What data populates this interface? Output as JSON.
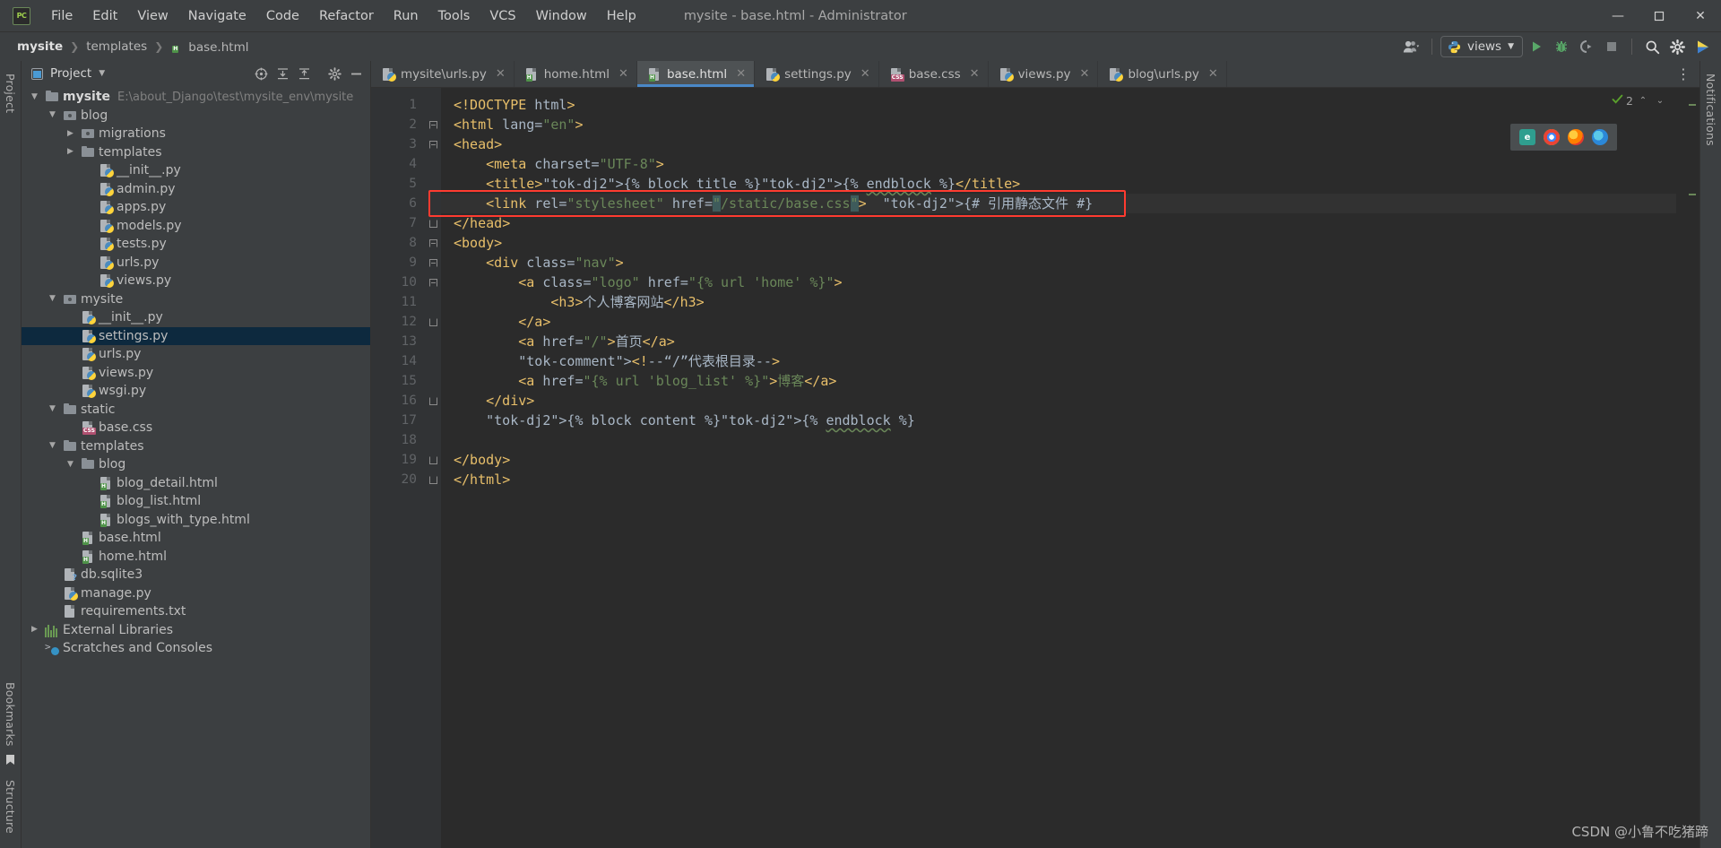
{
  "window": {
    "title": "mysite - base.html - Administrator",
    "logo_text": "PC",
    "minimize": "—",
    "maximize": "❐",
    "close": "✕"
  },
  "menubar": [
    {
      "label": "File"
    },
    {
      "label": "Edit"
    },
    {
      "label": "View"
    },
    {
      "label": "Navigate"
    },
    {
      "label": "Code"
    },
    {
      "label": "Refactor"
    },
    {
      "label": "Run"
    },
    {
      "label": "Tools"
    },
    {
      "label": "VCS"
    },
    {
      "label": "Window"
    },
    {
      "label": "Help"
    }
  ],
  "breadcrumb": {
    "items": [
      "mysite",
      "templates",
      "base.html"
    ],
    "separator": "❯"
  },
  "toolbar": {
    "run_config_label": "views",
    "run_tooltip": "Run",
    "debug_tooltip": "Debug",
    "coverage_tooltip": "Run with Coverage",
    "stop_tooltip": "Stop",
    "search_tooltip": "Search Everywhere",
    "settings_tooltip": "Settings",
    "user_tooltip": "Account"
  },
  "project_panel": {
    "title": "Project",
    "actions": [
      "target-icon",
      "expand-all-icon",
      "collapse-all-icon",
      "gear-icon",
      "hide-icon"
    ],
    "tree": [
      {
        "depth": 0,
        "arrow": "down",
        "icon": "folder",
        "label": "mysite",
        "bold": true,
        "path": "E:\\about_Django\\test\\mysite_env\\mysite",
        "selected": false
      },
      {
        "depth": 1,
        "arrow": "down",
        "icon": "module",
        "label": "blog",
        "selected": false
      },
      {
        "depth": 2,
        "arrow": "right",
        "icon": "module",
        "label": "migrations",
        "selected": false
      },
      {
        "depth": 2,
        "arrow": "right",
        "icon": "folder",
        "label": "templates",
        "selected": false
      },
      {
        "depth": 3,
        "arrow": "",
        "icon": "python",
        "label": "__init__.py",
        "selected": false
      },
      {
        "depth": 3,
        "arrow": "",
        "icon": "python",
        "label": "admin.py",
        "selected": false
      },
      {
        "depth": 3,
        "arrow": "",
        "icon": "python",
        "label": "apps.py",
        "selected": false
      },
      {
        "depth": 3,
        "arrow": "",
        "icon": "python",
        "label": "models.py",
        "selected": false
      },
      {
        "depth": 3,
        "arrow": "",
        "icon": "python",
        "label": "tests.py",
        "selected": false
      },
      {
        "depth": 3,
        "arrow": "",
        "icon": "python",
        "label": "urls.py",
        "selected": false
      },
      {
        "depth": 3,
        "arrow": "",
        "icon": "python",
        "label": "views.py",
        "selected": false
      },
      {
        "depth": 1,
        "arrow": "down",
        "icon": "module",
        "label": "mysite",
        "selected": false
      },
      {
        "depth": 2,
        "arrow": "",
        "icon": "python",
        "label": "__init__.py",
        "selected": false
      },
      {
        "depth": 2,
        "arrow": "",
        "icon": "python",
        "label": "settings.py",
        "selected": true
      },
      {
        "depth": 2,
        "arrow": "",
        "icon": "python",
        "label": "urls.py",
        "selected": false
      },
      {
        "depth": 2,
        "arrow": "",
        "icon": "python",
        "label": "views.py",
        "selected": false
      },
      {
        "depth": 2,
        "arrow": "",
        "icon": "python",
        "label": "wsgi.py",
        "selected": false
      },
      {
        "depth": 1,
        "arrow": "down",
        "icon": "folder",
        "label": "static",
        "selected": false
      },
      {
        "depth": 2,
        "arrow": "",
        "icon": "css",
        "label": "base.css",
        "selected": false
      },
      {
        "depth": 1,
        "arrow": "down",
        "icon": "folder",
        "label": "templates",
        "selected": false
      },
      {
        "depth": 2,
        "arrow": "down",
        "icon": "folder",
        "label": "blog",
        "selected": false
      },
      {
        "depth": 3,
        "arrow": "",
        "icon": "html",
        "label": "blog_detail.html",
        "selected": false
      },
      {
        "depth": 3,
        "arrow": "",
        "icon": "html",
        "label": "blog_list.html",
        "selected": false
      },
      {
        "depth": 3,
        "arrow": "",
        "icon": "html",
        "label": "blogs_with_type.html",
        "selected": false
      },
      {
        "depth": 2,
        "arrow": "",
        "icon": "html",
        "label": "base.html",
        "selected": false
      },
      {
        "depth": 2,
        "arrow": "",
        "icon": "html",
        "label": "home.html",
        "selected": false
      },
      {
        "depth": 1,
        "arrow": "",
        "icon": "db",
        "label": "db.sqlite3",
        "selected": false
      },
      {
        "depth": 1,
        "arrow": "",
        "icon": "python",
        "label": "manage.py",
        "selected": false
      },
      {
        "depth": 1,
        "arrow": "",
        "icon": "txt",
        "label": "requirements.txt",
        "selected": false
      },
      {
        "depth": 0,
        "arrow": "right",
        "icon": "lib",
        "label": "External Libraries",
        "selected": false
      },
      {
        "depth": 0,
        "arrow": "",
        "icon": "scratch",
        "label": "Scratches and Consoles",
        "selected": false
      }
    ]
  },
  "editor_tabs": [
    {
      "label": "mysite\\urls.py",
      "icon": "python",
      "active": false
    },
    {
      "label": "home.html",
      "icon": "html",
      "active": false
    },
    {
      "label": "base.html",
      "icon": "html",
      "active": true
    },
    {
      "label": "settings.py",
      "icon": "python",
      "active": false
    },
    {
      "label": "base.css",
      "icon": "css",
      "active": false
    },
    {
      "label": "views.py",
      "icon": "python",
      "active": false
    },
    {
      "label": "blog\\urls.py",
      "icon": "python",
      "active": false
    }
  ],
  "editor": {
    "line_numbers": [
      "1",
      "2",
      "3",
      "4",
      "5",
      "6",
      "7",
      "8",
      "9",
      "10",
      "11",
      "12",
      "13",
      "14",
      "15",
      "16",
      "17",
      "18",
      "19",
      "20"
    ],
    "lines": [
      "<!DOCTYPE html>",
      "<html lang=\"en\">",
      "<head>",
      "    <meta charset=\"UTF-8\">",
      "    <title>{% block title %}{% endblock %}</title>",
      "    <link rel=\"stylesheet\" href=\"/static/base.css\">  {# 引用静态文件 #}",
      "</head>",
      "<body>",
      "    <div class=\"nav\">",
      "        <a class=\"logo\" href=\"{% url 'home' %}\">",
      "            <h3>个人博客网站</h3>",
      "        </a>",
      "        <a href=\"/\">首页</a>",
      "        <!--“/”代表根目录-->",
      "        <a href=\"{% url 'blog_list' %}\">博客</a>",
      "    </div>",
      "    {% block content %}{% endblock %}",
      "",
      "</body>",
      "</html>"
    ],
    "highlighted_line": 6,
    "inspection_count": "2",
    "inspection_status": "check-ok"
  },
  "status": {
    "left_strip_top": "Project",
    "left_strip_bookmarks": "Bookmarks",
    "left_strip_structure": "Structure",
    "right_strip_notifications": "Notifications"
  },
  "watermark": "CSDN @小鲁不吃猪蹄",
  "colors": {
    "accent_tab": "#4a88c7",
    "selection": "#0d293e",
    "editor_bg": "#2b2b2b",
    "chrome_bg": "#3c3f41",
    "highlight_box": "#ff3b30",
    "string_green": "#6a8759",
    "tag_gold": "#e8bf6a"
  }
}
